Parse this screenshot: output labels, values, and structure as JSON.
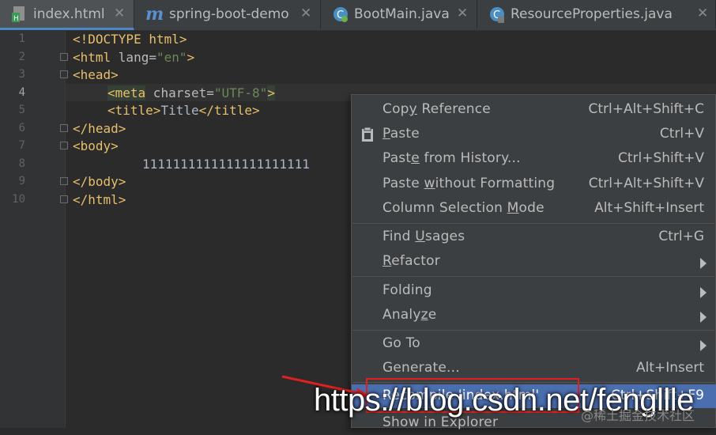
{
  "tabs": [
    {
      "label": "index.html",
      "icon": "html-file-icon",
      "active": true
    },
    {
      "label": "spring-boot-demo",
      "icon": "maven-module-icon",
      "active": false
    },
    {
      "label": "BootMain.java",
      "icon": "spring-boot-class-icon",
      "active": false
    },
    {
      "label": "ResourceProperties.java",
      "icon": "java-class-icon",
      "active": false
    }
  ],
  "close_glyph": "✕",
  "line_numbers": [
    "1",
    "2",
    "3",
    "4",
    "5",
    "6",
    "7",
    "8",
    "9",
    "10"
  ],
  "code": {
    "l1": "<!DOCTYPE html>",
    "l2_open": "<html ",
    "l2_attr": "lang=",
    "l2_val": "\"en\"",
    "l2_close": ">",
    "l3": "<head>",
    "l4_open": "<meta",
    "l4_attr": " charset=",
    "l4_val": "\"UTF-8\"",
    "l4_close": ">",
    "l5_open": "<title>",
    "l5_text": "Title",
    "l5_close": "</title>",
    "l6": "</head>",
    "l7": "<body>",
    "l8": "1111111111111111111111",
    "l9": "</body>",
    "l10": "</html>"
  },
  "context_menu": {
    "copy_reference": {
      "pre": "Cop",
      "u": "y",
      "post": " Reference",
      "shortcut": "Ctrl+Alt+Shift+C"
    },
    "paste": {
      "pre": "",
      "u": "P",
      "post": "aste",
      "shortcut": "Ctrl+V"
    },
    "paste_history": {
      "pre": "Past",
      "u": "e",
      "post": " from History...",
      "shortcut": "Ctrl+Shift+V"
    },
    "paste_no_format": {
      "pre": "Paste ",
      "u": "w",
      "post": "ithout Formatting",
      "shortcut": "Ctrl+Alt+Shift+V"
    },
    "column_mode": {
      "pre": "Column Selection ",
      "u": "M",
      "post": "ode",
      "shortcut": "Alt+Shift+Insert"
    },
    "find_usages": {
      "pre": "Find ",
      "u": "U",
      "post": "sages",
      "shortcut": "Ctrl+G"
    },
    "refactor": {
      "pre": "",
      "u": "R",
      "post": "efactor"
    },
    "folding": {
      "pre": "Folding",
      "u": "",
      "post": ""
    },
    "analyze": {
      "pre": "Analy",
      "u": "z",
      "post": "e"
    },
    "go_to": {
      "pre": "Go To",
      "u": "",
      "post": ""
    },
    "generate": {
      "pre": "Generate...",
      "u": "",
      "post": "",
      "shortcut": "Alt+Insert"
    },
    "recompile": {
      "label": "Recompile 'index.html'",
      "shortcut": "Ctrl+Shift+F9"
    },
    "show_explorer": {
      "label": "Show in Explorer"
    }
  },
  "watermark": "https://blog.csdn.net/fengllle",
  "watermark_small": "@稀土掘金技术社区",
  "colors": {
    "accent": "#4b6eaf",
    "annotation": "#e02020"
  }
}
